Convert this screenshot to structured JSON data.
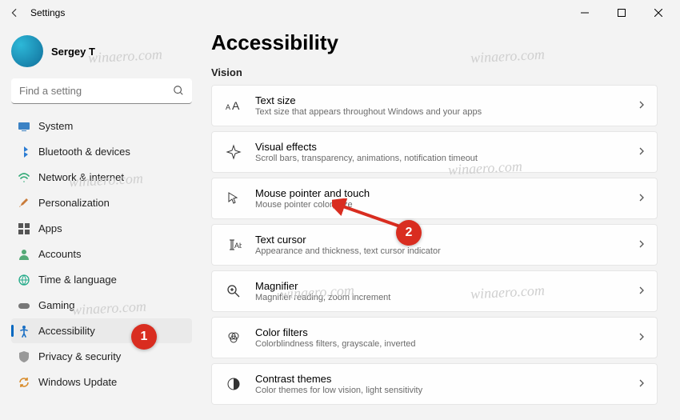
{
  "window": {
    "title": "Settings"
  },
  "user": {
    "name": "Sergey T"
  },
  "search": {
    "placeholder": "Find a setting"
  },
  "sidebar": {
    "items": [
      {
        "label": "System"
      },
      {
        "label": "Bluetooth & devices"
      },
      {
        "label": "Network & internet"
      },
      {
        "label": "Personalization"
      },
      {
        "label": "Apps"
      },
      {
        "label": "Accounts"
      },
      {
        "label": "Time & language"
      },
      {
        "label": "Gaming"
      },
      {
        "label": "Accessibility"
      },
      {
        "label": "Privacy & security"
      },
      {
        "label": "Windows Update"
      }
    ]
  },
  "page": {
    "title": "Accessibility",
    "section": "Vision"
  },
  "cards": [
    {
      "title": "Text size",
      "sub": "Text size that appears throughout Windows and your apps"
    },
    {
      "title": "Visual effects",
      "sub": "Scroll bars, transparency, animations, notification timeout"
    },
    {
      "title": "Mouse pointer and touch",
      "sub": "Mouse pointer color, size"
    },
    {
      "title": "Text cursor",
      "sub": "Appearance and thickness, text cursor indicator"
    },
    {
      "title": "Magnifier",
      "sub": "Magnifier reading, zoom increment"
    },
    {
      "title": "Color filters",
      "sub": "Colorblindness filters, grayscale, inverted"
    },
    {
      "title": "Contrast themes",
      "sub": "Color themes for low vision, light sensitivity"
    }
  ],
  "annotations": {
    "badge1": "1",
    "badge2": "2"
  },
  "watermark": "winaero.com"
}
